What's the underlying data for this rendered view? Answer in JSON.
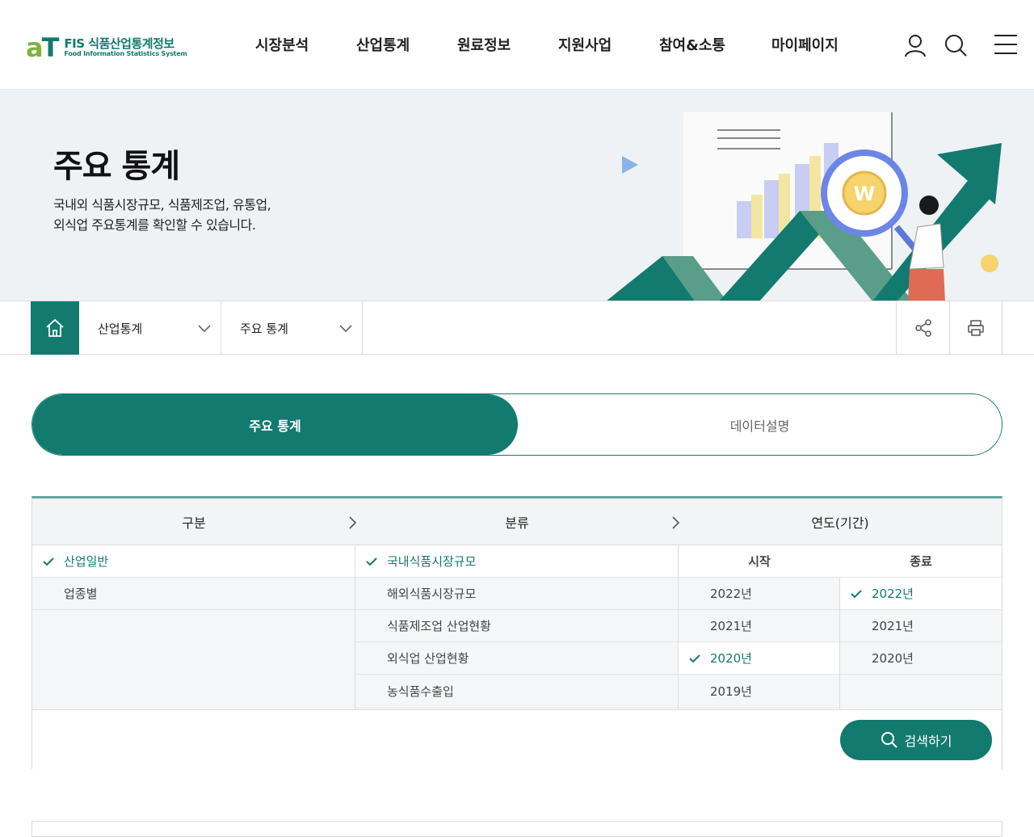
{
  "brand": {
    "mark_a": "a",
    "mark_t": "T",
    "title": "FIS 식품산업통계정보",
    "subtitle": "Food Information Statistics System",
    "colors": {
      "primary": "#137a6f",
      "leaf": "#7ab53d"
    }
  },
  "gnb": [
    "시장분석",
    "산업통계",
    "원료정보",
    "지원사업",
    "참여&소통",
    "마이페이지"
  ],
  "header_icons": [
    "user-icon",
    "search-icon",
    "menu-icon"
  ],
  "hero": {
    "title": "주요 통계",
    "description": "국내외 식품시장규모, 식품제조업, 유통업, 외식업 주요통계를 확인할 수 있습니다."
  },
  "breadcrumb": {
    "home_icon": "home-icon",
    "level1": "산업통계",
    "level2": "주요 통계",
    "share_icon": "share-icon",
    "print_icon": "print-icon"
  },
  "tabs": [
    {
      "label": "주요 통계",
      "active": true
    },
    {
      "label": "데이터설명",
      "active": false
    }
  ],
  "filter": {
    "headers": {
      "category": "구분",
      "classification": "분류",
      "year": "연도(기간)"
    },
    "year_subheaders": {
      "start": "시작",
      "end": "종료"
    },
    "category_items": [
      {
        "label": "산업일반",
        "selected": true
      },
      {
        "label": "업종별",
        "selected": false
      }
    ],
    "classification_items": [
      {
        "label": "국내식품시장규모",
        "selected": true
      },
      {
        "label": "해외식품시장규모",
        "selected": false
      },
      {
        "label": "식품제조업 산업현황",
        "selected": false
      },
      {
        "label": "외식업 산업현황",
        "selected": false
      },
      {
        "label": "농식품수출입",
        "selected": false
      }
    ],
    "start_years": [
      {
        "label": "2022년",
        "selected": false
      },
      {
        "label": "2021년",
        "selected": false
      },
      {
        "label": "2020년",
        "selected": true
      },
      {
        "label": "2019년",
        "selected": false
      }
    ],
    "end_years": [
      {
        "label": "2022년",
        "selected": true
      },
      {
        "label": "2021년",
        "selected": false
      },
      {
        "label": "2020년",
        "selected": false
      }
    ],
    "search_button": "검색하기"
  }
}
